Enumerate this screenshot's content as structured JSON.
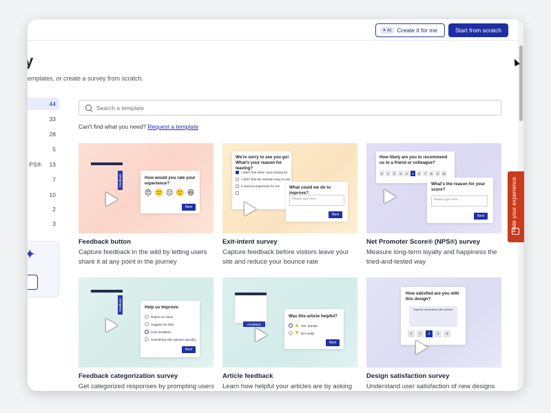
{
  "topbar": {
    "ai_chip": "AI",
    "ai_button_label": "Create it for me",
    "scratch_button_label": "Start from scratch"
  },
  "page": {
    "heading_fragment": "y",
    "subtitle_fragment": "emplates, or create a survey from scratch."
  },
  "sidebar": {
    "items": [
      {
        "label": "",
        "count": "44",
        "active": true
      },
      {
        "label": "",
        "count": "33"
      },
      {
        "label": "",
        "count": "28"
      },
      {
        "label": "",
        "count": "5"
      },
      {
        "label": "PS®",
        "count": "13"
      },
      {
        "label": "",
        "count": "7"
      },
      {
        "label": "",
        "count": "10"
      },
      {
        "label": "",
        "count": "2"
      },
      {
        "label": "",
        "count": "3"
      }
    ],
    "card_button_fragment": "ne"
  },
  "search": {
    "placeholder": "Search a template"
  },
  "request": {
    "text": "Can't find what you need?",
    "link": "Request a template"
  },
  "cards": [
    {
      "title": "Feedback button",
      "desc": "Capture feedback in the wild by letting users share it at any point in the journey",
      "preview": {
        "question": "How would you rate your experience?",
        "tab": "Feedback",
        "next": "Next"
      }
    },
    {
      "title": "Exit-intent survey",
      "desc": "Capture feedback before visitors leave your site and reduce your bounce rate",
      "preview": {
        "question": "We're sorry to see you go! What's your reason for leaving?",
        "options": [
          "I didn't find what I was looking for",
          "I didn't find the website easy to use",
          "It was too expensive for me"
        ],
        "followup": "What could we do to improve?",
        "field": "Please type here...",
        "next": "Next"
      }
    },
    {
      "title": "Net Promoter Score® (NPS®) survey",
      "desc": "Measure long-term loyalty and happiness the tried-and-tested way",
      "preview": {
        "question": "How likely are you to recommend us to a friend or colleague?",
        "scale": [
          "0",
          "1",
          "2",
          "3",
          "4",
          "5",
          "6",
          "7",
          "8",
          "9",
          "10"
        ],
        "followup": "What's the reason for your score?",
        "field": "Please type here...",
        "next": "Next"
      }
    },
    {
      "title": "Feedback categorization survey",
      "desc": "Get categorized responses by prompting users",
      "preview": {
        "question": "Help us improve:",
        "options": [
          "Report an issue",
          "Suggest an idea",
          "Give feedback",
          "Something else (please specify)"
        ],
        "tab": "Feedback",
        "next": "Next"
      }
    },
    {
      "title": "Article feedback",
      "desc": "Learn how helpful your articles are by asking",
      "preview": {
        "question": "Was this article helpful?",
        "options": [
          "Yes, thanks!",
          "Not really"
        ],
        "tab": "Feedback",
        "next": "Next"
      }
    },
    {
      "title": "Design satisfaction survey",
      "desc": "Understand user satisfaction of new designs",
      "preview": {
        "question": "How satisfied are you with this design?",
        "banner": "Improve conversions with science",
        "scale": [
          "1",
          "2",
          "3",
          "4",
          "5"
        ]
      }
    }
  ],
  "rate_tab": {
    "label": "Rate your experience"
  },
  "colors": {
    "primary": "#1f2fa3",
    "rate_tab": "#c93b1c"
  }
}
